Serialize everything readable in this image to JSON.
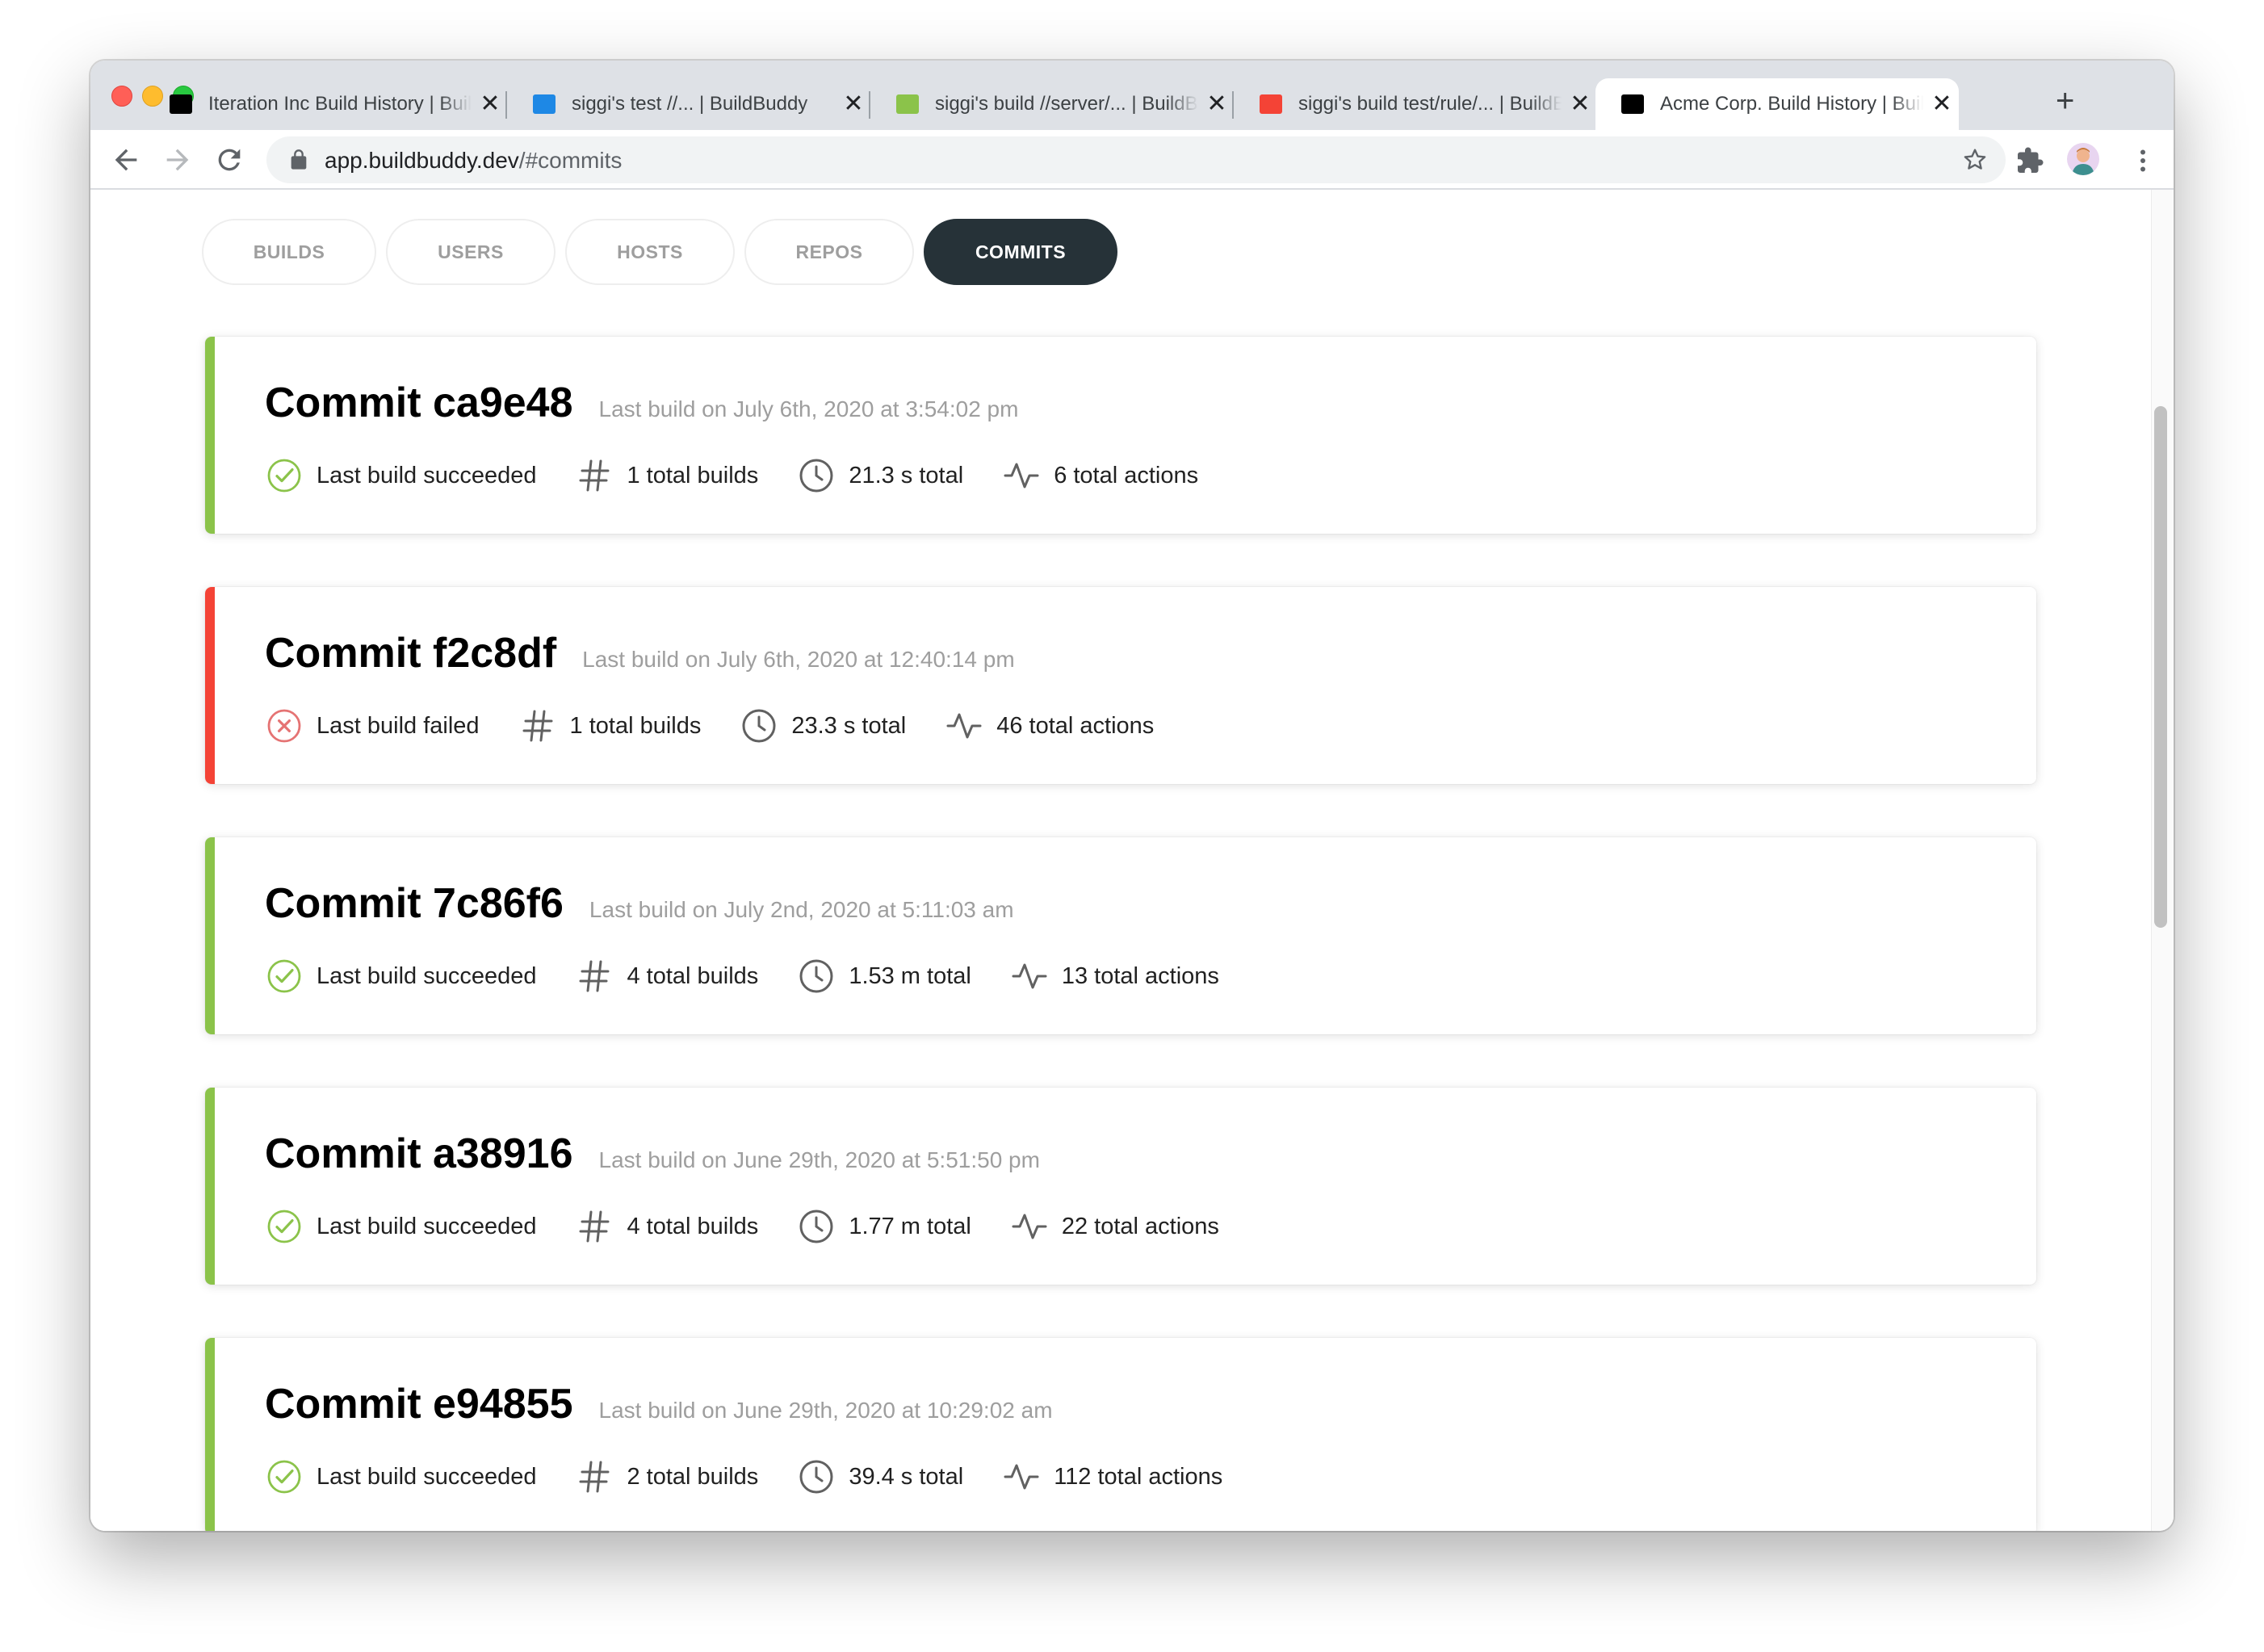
{
  "browser": {
    "tabs": [
      {
        "title": "Iteration Inc Build History | BuildBuddy",
        "favicon_color": "#000000",
        "active": false
      },
      {
        "title": "siggi's test //... | BuildBuddy",
        "favicon_color": "#1e88e5",
        "active": false
      },
      {
        "title": "siggi's build //server/... | BuildBuddy",
        "favicon_color": "#8bc34a",
        "active": false
      },
      {
        "title": "siggi's build test/rule/... | BuildBuddy",
        "favicon_color": "#f44336",
        "active": false
      },
      {
        "title": "Acme Corp. Build History | BuildBuddy",
        "favicon_color": "#000000",
        "active": true
      }
    ],
    "close_glyph": "✕",
    "new_tab_glyph": "+",
    "url_host": "app.buildbuddy.dev",
    "url_path": "/#commits"
  },
  "filters": {
    "tabs": [
      {
        "label": "BUILDS",
        "active": false
      },
      {
        "label": "USERS",
        "active": false
      },
      {
        "label": "HOSTS",
        "active": false
      },
      {
        "label": "REPOS",
        "active": false
      },
      {
        "label": "COMMITS",
        "active": true
      }
    ]
  },
  "colors": {
    "success": "#8bc34a",
    "failure": "#f44336",
    "active_tab": "#263238"
  },
  "commits": [
    {
      "title": "Commit ca9e48",
      "subtitle": "Last build on July 6th, 2020 at 3:54:02 pm",
      "status": "success",
      "status_text": "Last build succeeded",
      "builds": "1 total builds",
      "duration": "21.3 s total",
      "actions": "6 total actions"
    },
    {
      "title": "Commit f2c8df",
      "subtitle": "Last build on July 6th, 2020 at 12:40:14 pm",
      "status": "failure",
      "status_text": "Last build failed",
      "builds": "1 total builds",
      "duration": "23.3 s total",
      "actions": "46 total actions"
    },
    {
      "title": "Commit 7c86f6",
      "subtitle": "Last build on July 2nd, 2020 at 5:11:03 am",
      "status": "success",
      "status_text": "Last build succeeded",
      "builds": "4 total builds",
      "duration": "1.53 m total",
      "actions": "13 total actions"
    },
    {
      "title": "Commit a38916",
      "subtitle": "Last build on June 29th, 2020 at 5:51:50 pm",
      "status": "success",
      "status_text": "Last build succeeded",
      "builds": "4 total builds",
      "duration": "1.77 m total",
      "actions": "22 total actions"
    },
    {
      "title": "Commit e94855",
      "subtitle": "Last build on June 29th, 2020 at 10:29:02 am",
      "status": "success",
      "status_text": "Last build succeeded",
      "builds": "2 total builds",
      "duration": "39.4 s total",
      "actions": "112 total actions"
    }
  ]
}
